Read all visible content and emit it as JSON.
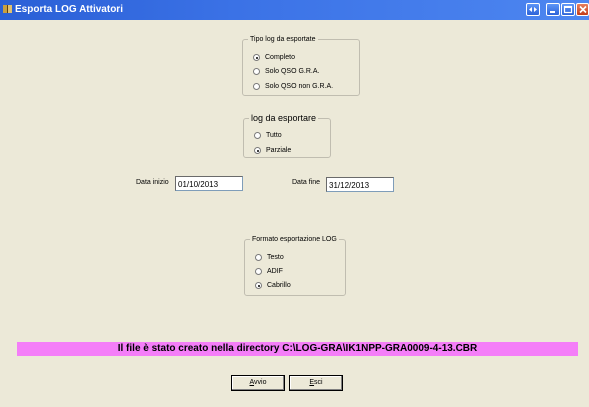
{
  "window": {
    "title": "Esporta LOG Attivatori"
  },
  "tipo_log": {
    "legend": "Tipo log da esportate",
    "options": [
      "Completo",
      "Solo QSO G.R.A.",
      "Solo QSO non G.R.A."
    ],
    "selected": "Completo"
  },
  "log_esportare": {
    "legend": "log da esportare",
    "options": [
      "Tutto",
      "Parziale"
    ],
    "selected": "Parziale"
  },
  "date": {
    "inizio_label": "Data inizio",
    "inizio_value": "01/10/2013",
    "fine_label": "Data fine",
    "fine_value": "31/12/2013"
  },
  "formato": {
    "legend": "Formato esportazione  LOG",
    "options": [
      "Testo",
      "ADIF",
      "Cabrillo"
    ],
    "selected": "Cabrillo"
  },
  "status": {
    "message": "Il file è stato creato nella directory C:\\LOG-GRA\\IK1NPP-GRA0009-4-13.CBR"
  },
  "buttons": {
    "avvio_first": "A",
    "avvio_rest": "vvio",
    "esci_first": "E",
    "esci_rest": "sci"
  },
  "colors": {
    "titlebar": "#3b72e6",
    "banner": "#f47ef8",
    "background": "#ece9d8"
  }
}
